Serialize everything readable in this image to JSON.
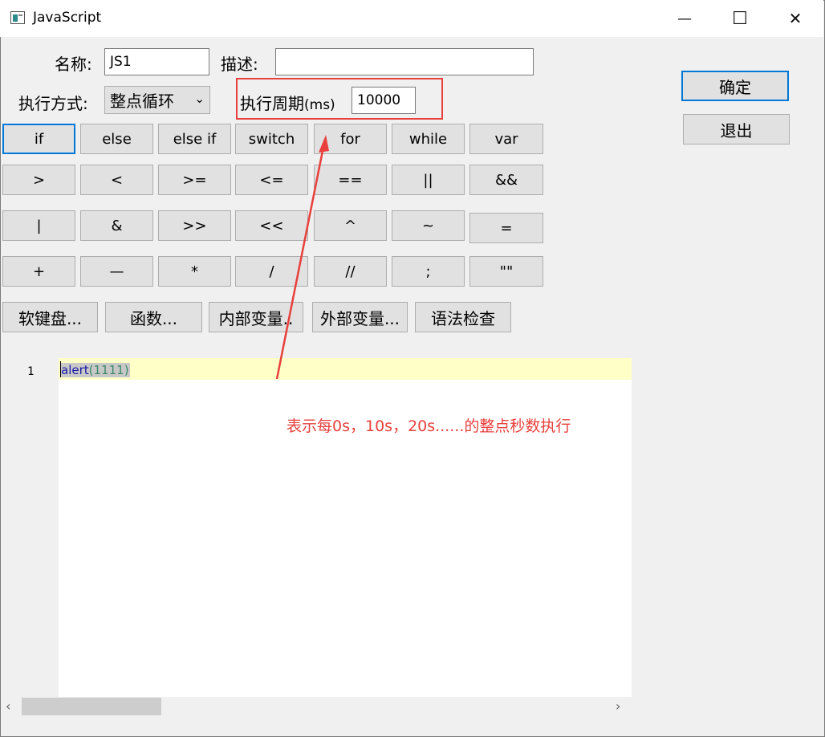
{
  "window": {
    "title": "JavaScript",
    "minimize": "—",
    "maximize": "☐",
    "close": "✕"
  },
  "form": {
    "name_label": "名称:",
    "name_value": "JS1",
    "desc_label": "描述:",
    "desc_value": "",
    "mode_label": "执行方式:",
    "mode_value": "整点循环",
    "period_label": "执行周期",
    "period_unit": "(ms)",
    "period_value": "10000"
  },
  "actions": {
    "ok": "确定",
    "exit": "退出"
  },
  "keypad": {
    "rows": [
      [
        "if",
        "else",
        "else if",
        "switch",
        "for",
        "while",
        "var"
      ],
      [
        ">",
        "<",
        ">=",
        "<=",
        "==",
        "||",
        "&&"
      ],
      [
        "|",
        "&",
        ">>",
        "<<",
        "^",
        "~",
        "="
      ],
      [
        "+",
        "—",
        "*",
        "/",
        "//",
        ";",
        "\"\""
      ]
    ]
  },
  "tools": {
    "soft_keyboard": "软键盘...",
    "functions": "函数...",
    "internal_vars": "内部变量..",
    "external_vars": "外部变量...",
    "syntax_check": "语法检查"
  },
  "editor": {
    "line_number": "1",
    "code_fn": "alert",
    "code_open": "(",
    "code_num": "1111",
    "code_close": ")"
  },
  "annotation": {
    "text": "表示每0s，10s，20s......的整点秒数执行",
    "color": "#e8403c"
  },
  "scrollbar": {
    "left_arrow": "‹",
    "right_arrow": "›"
  }
}
